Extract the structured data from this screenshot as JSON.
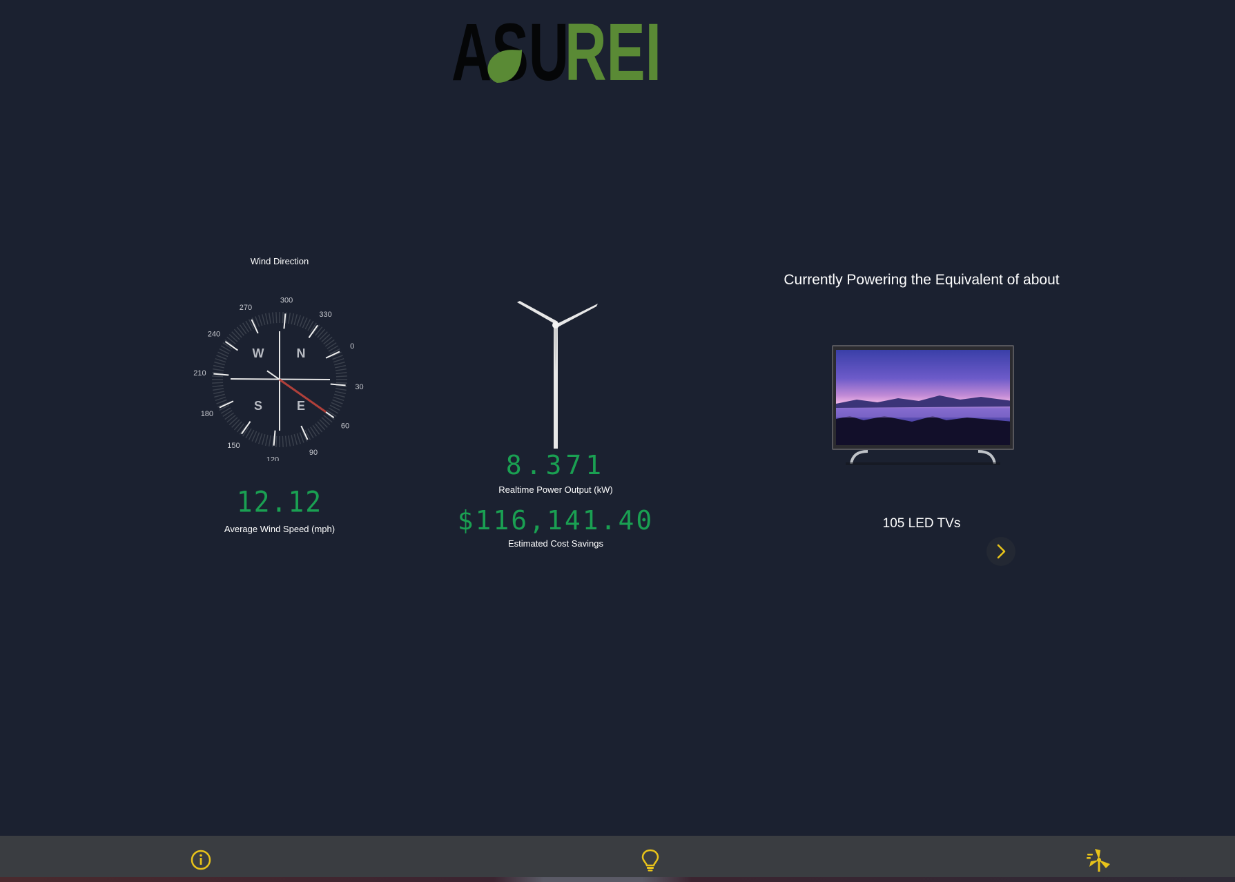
{
  "brand": {
    "logo_text_dark": "ASU",
    "logo_text_green": "REI",
    "logo_color_green": "#5a8a35"
  },
  "wind": {
    "title": "Wind Direction",
    "direction_degrees": 60,
    "dial_labels": [
      "0",
      "30",
      "60",
      "90",
      "120",
      "150",
      "180",
      "210",
      "240",
      "270",
      "300",
      "330"
    ],
    "cardinals": {
      "n": "N",
      "e": "E",
      "s": "S",
      "w": "W"
    },
    "average_speed": "12.12",
    "average_speed_label": "Average Wind Speed (mph)"
  },
  "power": {
    "output": "8.371",
    "output_label": "Realtime Power Output (kW)",
    "savings": "$116,141.40",
    "savings_label": "Estimated Cost Savings"
  },
  "equivalent": {
    "title": "Currently Powering the Equivalent of about",
    "count_text": "105 LED TVs",
    "next_icon": "chevron-right-icon"
  },
  "nav": {
    "items": [
      {
        "icon": "info-icon"
      },
      {
        "icon": "lightbulb-icon"
      },
      {
        "icon": "wind-turbine-icon"
      }
    ],
    "accent": "#e8c31a"
  },
  "colors": {
    "background": "#1b2130",
    "digital": "#1aa052",
    "needle": "#b0403a"
  }
}
